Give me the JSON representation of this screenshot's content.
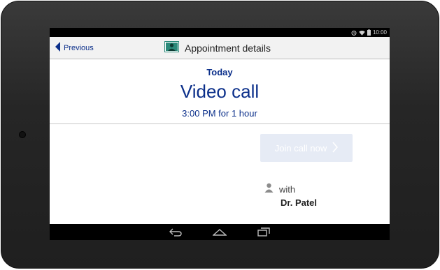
{
  "status_bar": {
    "time": "10:00",
    "icons": [
      "alarm-icon",
      "wifi-icon",
      "battery-icon"
    ]
  },
  "action_bar": {
    "back_label": "Previous",
    "title": "Appointment details",
    "icons": [
      "back-arrow-icon",
      "appointment-person-icon"
    ]
  },
  "appointment": {
    "day": "Today",
    "type": "Video call",
    "time": "3:00 PM for 1 hour",
    "join_label": "Join call now",
    "with_label": "with",
    "doctor": "Dr. Patel"
  },
  "nav_bar": {
    "icons": [
      "nav-back-icon",
      "nav-home-icon",
      "nav-recents-icon"
    ]
  },
  "colors": {
    "accent": "#0b2f8a",
    "join_button_bg": "#e6ebf5",
    "action_bar_bg": "#f2f2f2",
    "icon_teal": "#2b8a7a"
  }
}
